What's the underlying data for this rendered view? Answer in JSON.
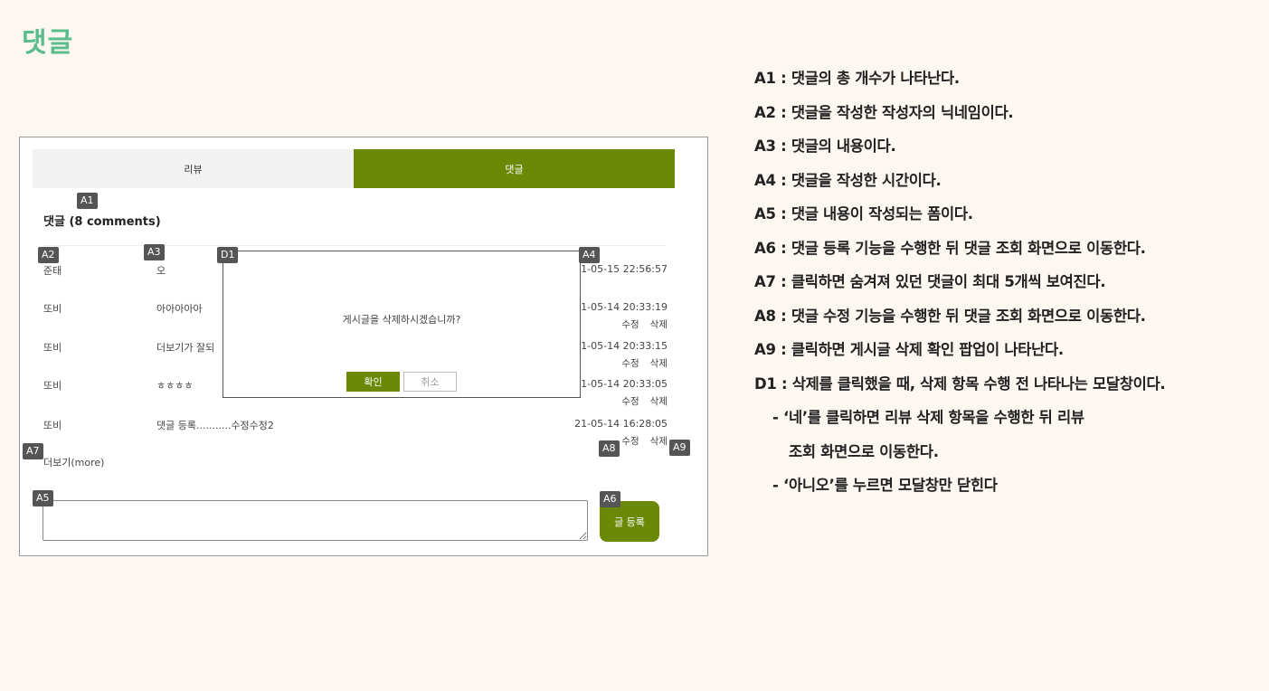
{
  "page": {
    "title": "댓글"
  },
  "mock": {
    "tabs": [
      {
        "label": "리뷰",
        "active": false
      },
      {
        "label": "댓글",
        "active": true
      }
    ],
    "count_title": "댓글 (8 comments)",
    "comments": [
      {
        "author": "준태",
        "content": "오",
        "time": "21-05-15 22:56:57",
        "edit": "",
        "delete": ""
      },
      {
        "author": "또비",
        "content": "아아아아아",
        "time": "21-05-14 20:33:19",
        "edit": "수정",
        "delete": "삭제"
      },
      {
        "author": "또비",
        "content": "더보기가 잘되",
        "time": "21-05-14 20:33:15",
        "edit": "수정",
        "delete": "삭제"
      },
      {
        "author": "또비",
        "content": "ㅎㅎㅎㅎ",
        "time": "21-05-14 20:33:05",
        "edit": "수정",
        "delete": "삭제"
      },
      {
        "author": "또비",
        "content": "댓글 등록...........수정수정2",
        "time": "21-05-14 16:28:05",
        "edit": "수정",
        "delete": "삭제"
      }
    ],
    "more_label": "더보기(more)",
    "input_value": "",
    "submit_label": "글 등록",
    "modal": {
      "message": "게시글을 삭제하시겠습니까?",
      "ok_label": "확인",
      "cancel_label": "취소"
    },
    "colors": {
      "accent": "#6b8806",
      "title": "#5bbd8d",
      "badge": "#555555"
    }
  },
  "badges": {
    "a1": "A1",
    "a2": "A2",
    "a3": "A3",
    "a4": "A4",
    "a5": "A5",
    "a6": "A6",
    "a7": "A7",
    "a8": "A8",
    "a9": "A9",
    "d1": "D1"
  },
  "descriptions": [
    "A1 : 댓글의 총 개수가 나타난다.",
    "A2 : 댓글을 작성한 작성자의 닉네임이다.",
    "A3 : 댓글의 내용이다.",
    "A4 : 댓글을 작성한 시간이다.",
    "A5 : 댓글 내용이 작성되는 폼이다.",
    "A6 : 댓글 등록 기능을 수행한 뒤 댓글 조회 화면으로 이동한다.",
    "A7 : 클릭하면 숨겨져 있던 댓글이 최대 5개씩 보여진다.",
    "A8 : 댓글 수정 기능을 수행한 뒤 댓글 조회 화면으로 이동한다.",
    "A9 : 클릭하면 게시글 삭제 확인 팝업이 나타난다.",
    "D1 : 삭제를 클릭했을 때, 삭제 항목 수행 전 나타나는 모달창이다.",
    "- ‘네’를 클릭하면 리뷰 삭제 항목을 수행한 뒤 리뷰",
    "조회 화면으로 이동한다.",
    "- ‘아니오’를 누르면 모달창만 닫힌다"
  ]
}
